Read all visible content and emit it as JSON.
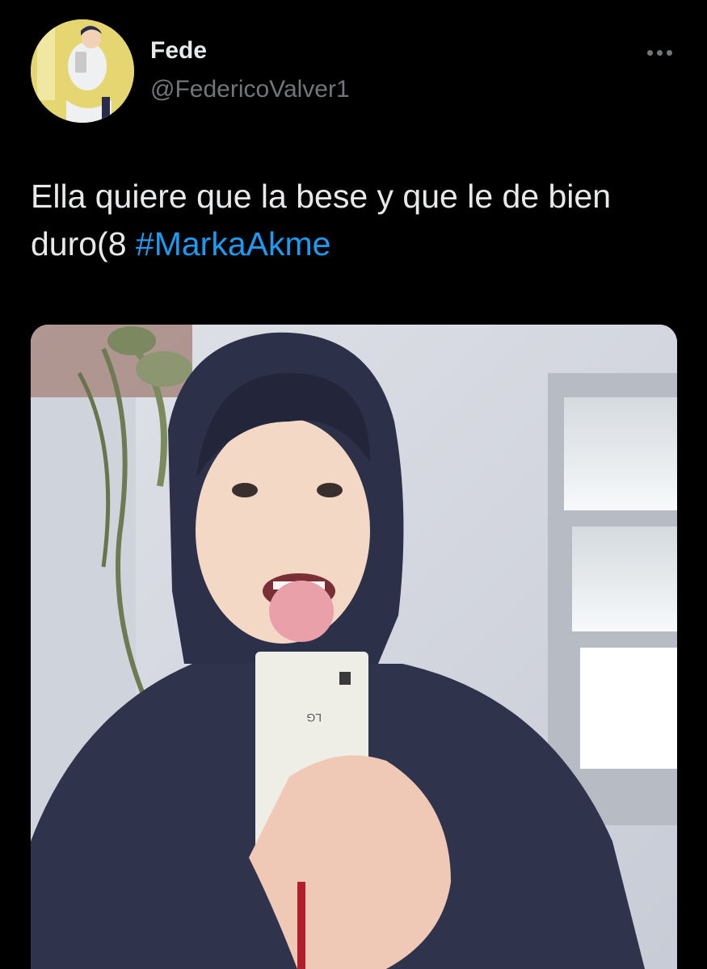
{
  "tweet": {
    "author": {
      "name": "Fede",
      "handle": "@FedericoValver1"
    },
    "text_plain": "Ella quiere que la bese y que le de bien duro(8 ",
    "hashtag": "#MarkaAkme",
    "more_icon": "more-horizontal-icon"
  },
  "colors": {
    "background": "#000000",
    "primary_text": "#e7e9ea",
    "secondary_text": "#71767b",
    "link": "#1d9bf0"
  }
}
